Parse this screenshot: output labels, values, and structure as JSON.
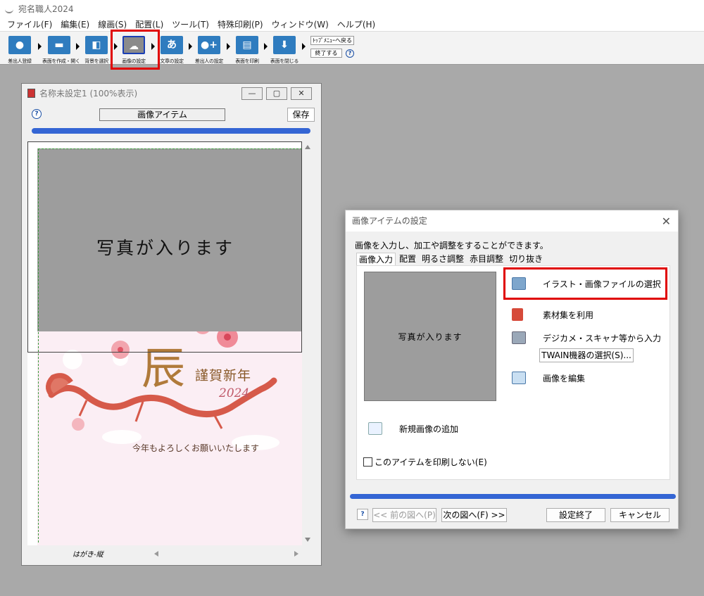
{
  "app": {
    "title": "宛名職人2024"
  },
  "menu": [
    "ファイル(F)",
    "編集(E)",
    "線画(S)",
    "配置(L)",
    "ツール(T)",
    "特殊印刷(P)",
    "ウィンドウ(W)",
    "ヘルプ(H)"
  ],
  "toolbar": {
    "buttons": [
      {
        "label": "差出人登録",
        "icon": "person-icon"
      },
      {
        "label": "表面を作成・開く",
        "icon": "folder-icon"
      },
      {
        "label": "背景を選択",
        "icon": "picture-icon"
      },
      {
        "label": "画像の設定",
        "icon": "image-settings-icon",
        "active": true
      },
      {
        "label": "文章の設定",
        "icon": "text-icon"
      },
      {
        "label": "差出人の設定",
        "icon": "add-person-icon"
      },
      {
        "label": "表面を印刷",
        "icon": "printer-icon"
      },
      {
        "label": "表面を閉じる",
        "icon": "download-icon"
      }
    ],
    "top_menu_label": "ﾄｯﾌﾟﾒﾆｭｰへ戻る",
    "exit_label": "終了する",
    "help": "?",
    "icon_glyphs": [
      "●",
      "▬",
      "◧",
      "☁",
      "あ",
      "●+",
      "▤",
      "⬇"
    ]
  },
  "doc": {
    "title": "名称未設定1 (100%表示)",
    "field_label": "画像アイテム",
    "save_label": "保存",
    "help": "?",
    "photo_text": "写真が入ります",
    "greeting_kanji": "辰",
    "greeting_title": "謹賀新年",
    "greeting_year": "2024",
    "greeting_message": "今年もよろしくお願いいたします",
    "status_label": "はがき-縦",
    "win_buttons": [
      "—",
      "▢",
      "✕"
    ]
  },
  "dialog": {
    "title": "画像アイテムの設定",
    "close": "✕",
    "description": "画像を入力し、加工や調整をすることができます。",
    "tabs": [
      "画像入力",
      "配置",
      "明るさ調整",
      "赤目調整",
      "切り抜き"
    ],
    "preview_text": "写真が入ります",
    "actions": {
      "select_file": "イラスト・画像ファイルの選択",
      "material": "素材集を利用",
      "camera": "デジカメ・スキャナ等から入力",
      "twain": "TWAIN機器の選択(S)...",
      "edit": "画像を編集",
      "new_image": "新規画像の追加"
    },
    "checkbox_label": "このアイテムを印刷しない(E)",
    "help": "?",
    "prev_label": "<< 前の図へ(P)",
    "next_label": "次の図へ(F) >>",
    "ok_label": "設定終了",
    "cancel_label": "キャンセル"
  }
}
